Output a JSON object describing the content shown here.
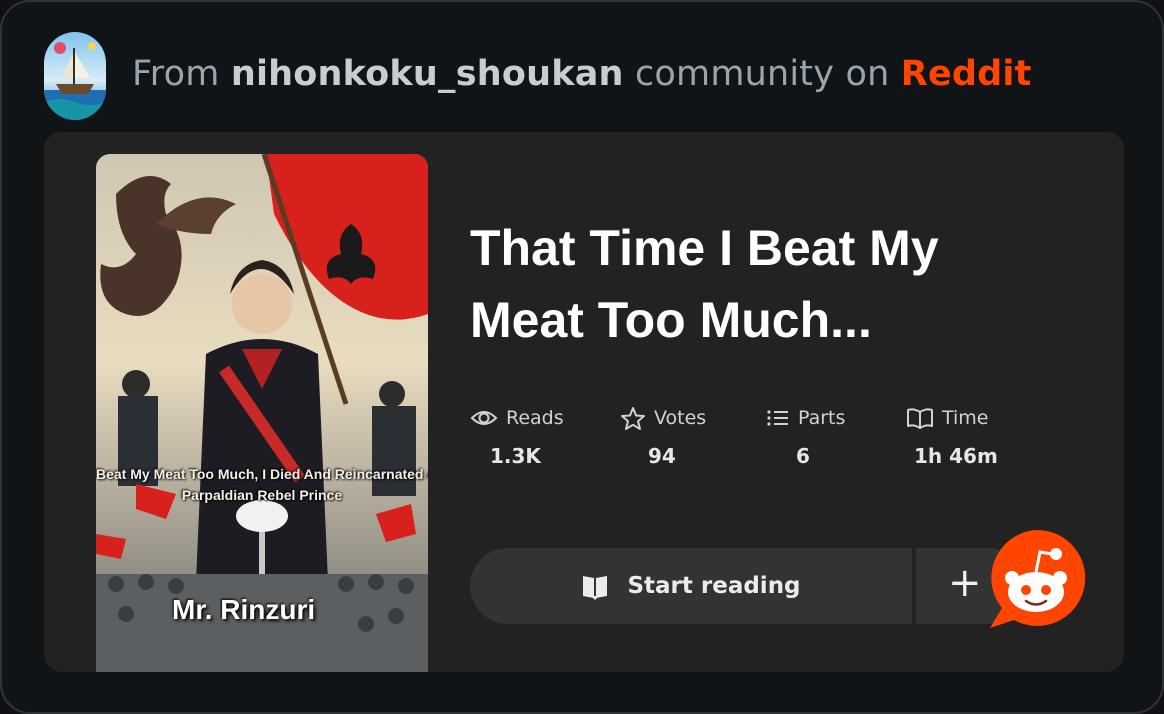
{
  "header": {
    "prefix": "From",
    "community": "nihonkoku_shoukan",
    "middle": "community on",
    "brand": "Reddit",
    "brand_color": "#ff4500"
  },
  "story": {
    "title_line1": "That Time I Beat My",
    "title_line2": "Meat Too Much...",
    "cover": {
      "subtitle_line1": "Beat My Meat Too Much, I Died And Reincarnated A",
      "subtitle_line2": "Parpaldian Rebel Prince",
      "author": "Mr. Rinzuri"
    },
    "stats": [
      {
        "icon": "eye-icon",
        "label": "Reads",
        "value": "1.3K"
      },
      {
        "icon": "star-icon",
        "label": "Votes",
        "value": "94"
      },
      {
        "icon": "list-icon",
        "label": "Parts",
        "value": "6"
      },
      {
        "icon": "book-icon",
        "label": "Time",
        "value": "1h 46m"
      }
    ]
  },
  "actions": {
    "start_label": "Start reading",
    "add_label": "+"
  }
}
